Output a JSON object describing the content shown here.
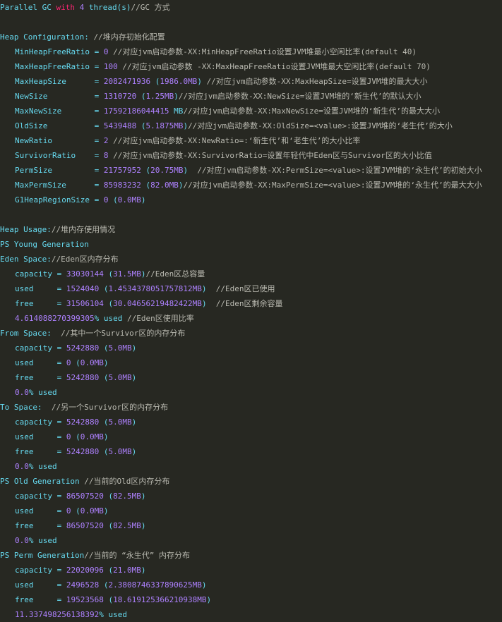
{
  "colors": {
    "background": "#272822",
    "keyword": "#66d9ef",
    "number": "#ae81ff",
    "reserved": "#f92672",
    "comment": "#b9b9b0",
    "text": "#f8f8f2"
  },
  "lines": [
    {
      "y": 0,
      "tokens": [
        {
          "t": "Parallel GC ",
          "s": "k"
        },
        {
          "t": "with",
          "s": "r"
        },
        {
          "t": " ",
          "s": "p"
        },
        {
          "t": "4",
          "s": "m"
        },
        {
          "t": " thread(s)",
          "s": "k"
        },
        {
          "t": "//GC 方式",
          "s": "c"
        }
      ]
    },
    {
      "y": 1,
      "tokens": []
    },
    {
      "y": 2,
      "tokens": [
        {
          "t": "Heap Configuration: ",
          "s": "k"
        },
        {
          "t": "//堆内存初始化配置",
          "s": "c"
        }
      ]
    },
    {
      "y": 3,
      "indent": 1,
      "tokens": [
        {
          "t": "MinHeapFreeRatio = ",
          "s": "k"
        },
        {
          "t": "0",
          "s": "m"
        },
        {
          "t": " //对应jvm启动参数-XX:MinHeapFreeRatio设置JVM堆最小空闲比率(default 40)",
          "s": "c"
        }
      ]
    },
    {
      "y": 4,
      "indent": 1,
      "tokens": [
        {
          "t": "MaxHeapFreeRatio = ",
          "s": "k"
        },
        {
          "t": "100",
          "s": "m"
        },
        {
          "t": " //对应jvm启动参数 -XX:MaxHeapFreeRatio设置JVM堆最大空闲比率(default 70)",
          "s": "c"
        }
      ]
    },
    {
      "y": 5,
      "indent": 1,
      "tokens": [
        {
          "t": "MaxHeapSize      = ",
          "s": "k"
        },
        {
          "t": "2082471936",
          "s": "m"
        },
        {
          "t": " (",
          "s": "k"
        },
        {
          "t": "1986.0MB",
          "s": "m"
        },
        {
          "t": ") ",
          "s": "k"
        },
        {
          "t": "//对应jvm启动参数-XX:MaxHeapSize=设置JVM堆的最大大小",
          "s": "c"
        }
      ]
    },
    {
      "y": 6,
      "indent": 1,
      "tokens": [
        {
          "t": "NewSize          = ",
          "s": "k"
        },
        {
          "t": "1310720",
          "s": "m"
        },
        {
          "t": " (",
          "s": "k"
        },
        {
          "t": "1.25MB",
          "s": "m"
        },
        {
          "t": ")",
          "s": "k"
        },
        {
          "t": "//对应jvm启动参数-XX:NewSize=设置JVM堆的‘新生代’的默认大小",
          "s": "c"
        }
      ]
    },
    {
      "y": 7,
      "indent": 1,
      "tokens": [
        {
          "t": "MaxNewSize       = ",
          "s": "k"
        },
        {
          "t": "17592186044415",
          "s": "m"
        },
        {
          "t": " MB",
          "s": "k"
        },
        {
          "t": "//对应jvm启动参数-XX:MaxNewSize=设置JVM堆的‘新生代’的最大大小",
          "s": "c"
        }
      ]
    },
    {
      "y": 8,
      "indent": 1,
      "tokens": [
        {
          "t": "OldSize          = ",
          "s": "k"
        },
        {
          "t": "5439488",
          "s": "m"
        },
        {
          "t": " (",
          "s": "k"
        },
        {
          "t": "5.1875MB",
          "s": "m"
        },
        {
          "t": ")",
          "s": "k"
        },
        {
          "t": "//对应jvm启动参数-XX:OldSize=<value>:设置JVM堆的‘老生代’的大小",
          "s": "c"
        }
      ]
    },
    {
      "y": 9,
      "indent": 1,
      "tokens": [
        {
          "t": "NewRatio         = ",
          "s": "k"
        },
        {
          "t": "2",
          "s": "m"
        },
        {
          "t": " //对应jvm启动参数-XX:NewRatio=:‘新生代’和‘老生代’的大小比率",
          "s": "c"
        }
      ]
    },
    {
      "y": 10,
      "indent": 1,
      "tokens": [
        {
          "t": "SurvivorRatio    = ",
          "s": "k"
        },
        {
          "t": "8",
          "s": "m"
        },
        {
          "t": " //对应jvm启动参数-XX:SurvivorRatio=设置年轻代中Eden区与Survivor区的大小比值",
          "s": "c"
        }
      ]
    },
    {
      "y": 11,
      "indent": 1,
      "tokens": [
        {
          "t": "PermSize         = ",
          "s": "k"
        },
        {
          "t": "21757952",
          "s": "m"
        },
        {
          "t": " (",
          "s": "k"
        },
        {
          "t": "20.75MB",
          "s": "m"
        },
        {
          "t": ")  ",
          "s": "k"
        },
        {
          "t": "//对应jvm启动参数-XX:PermSize=<value>:设置JVM堆的‘永生代’的初始大小",
          "s": "c"
        }
      ]
    },
    {
      "y": 12,
      "indent": 1,
      "tokens": [
        {
          "t": "MaxPermSize      = ",
          "s": "k"
        },
        {
          "t": "85983232",
          "s": "m"
        },
        {
          "t": " (",
          "s": "k"
        },
        {
          "t": "82.0MB",
          "s": "m"
        },
        {
          "t": ")",
          "s": "k"
        },
        {
          "t": "//对应jvm启动参数-XX:MaxPermSize=<value>:设置JVM堆的‘永生代’的最大大小",
          "s": "c"
        }
      ]
    },
    {
      "y": 13,
      "indent": 1,
      "tokens": [
        {
          "t": "G1HeapRegionSize = ",
          "s": "k"
        },
        {
          "t": "0",
          "s": "m"
        },
        {
          "t": " (",
          "s": "k"
        },
        {
          "t": "0.0MB",
          "s": "m"
        },
        {
          "t": ")",
          "s": "k"
        }
      ]
    },
    {
      "y": 14,
      "tokens": []
    },
    {
      "y": 15,
      "tokens": [
        {
          "t": "Heap Usage:",
          "s": "k"
        },
        {
          "t": "//堆内存使用情况",
          "s": "c"
        }
      ]
    },
    {
      "y": 16,
      "tokens": [
        {
          "t": "PS Young Generation",
          "s": "k"
        }
      ]
    },
    {
      "y": 17,
      "tokens": [
        {
          "t": "Eden Space:",
          "s": "k"
        },
        {
          "t": "//Eden区内存分布",
          "s": "c"
        }
      ]
    },
    {
      "y": 18,
      "indent": 1,
      "tokens": [
        {
          "t": "capacity = ",
          "s": "k"
        },
        {
          "t": "33030144",
          "s": "m"
        },
        {
          "t": " (",
          "s": "k"
        },
        {
          "t": "31.5MB",
          "s": "m"
        },
        {
          "t": ")",
          "s": "k"
        },
        {
          "t": "//Eden区总容量",
          "s": "c"
        }
      ]
    },
    {
      "y": 19,
      "indent": 1,
      "tokens": [
        {
          "t": "used     = ",
          "s": "k"
        },
        {
          "t": "1524040",
          "s": "m"
        },
        {
          "t": " (",
          "s": "k"
        },
        {
          "t": "1.4534378051757812MB",
          "s": "m"
        },
        {
          "t": ")  ",
          "s": "k"
        },
        {
          "t": "//Eden区已使用",
          "s": "c"
        }
      ]
    },
    {
      "y": 20,
      "indent": 1,
      "tokens": [
        {
          "t": "free     = ",
          "s": "k"
        },
        {
          "t": "31506104",
          "s": "m"
        },
        {
          "t": " (",
          "s": "k"
        },
        {
          "t": "30.04656219482422MB",
          "s": "m"
        },
        {
          "t": ")  ",
          "s": "k"
        },
        {
          "t": "//Eden区剩余容量",
          "s": "c"
        }
      ]
    },
    {
      "y": 21,
      "indent": 1,
      "tokens": [
        {
          "t": "4.614088270399305",
          "s": "m"
        },
        {
          "t": "% used ",
          "s": "k"
        },
        {
          "t": "//Eden区使用比率",
          "s": "c"
        }
      ]
    },
    {
      "y": 22,
      "tokens": [
        {
          "t": "From Space:  ",
          "s": "k"
        },
        {
          "t": "//其中一个Survivor区的内存分布",
          "s": "c"
        }
      ]
    },
    {
      "y": 23,
      "indent": 1,
      "tokens": [
        {
          "t": "capacity = ",
          "s": "k"
        },
        {
          "t": "5242880",
          "s": "m"
        },
        {
          "t": " (",
          "s": "k"
        },
        {
          "t": "5.0MB",
          "s": "m"
        },
        {
          "t": ")",
          "s": "k"
        }
      ]
    },
    {
      "y": 24,
      "indent": 1,
      "tokens": [
        {
          "t": "used     = ",
          "s": "k"
        },
        {
          "t": "0",
          "s": "m"
        },
        {
          "t": " (",
          "s": "k"
        },
        {
          "t": "0.0MB",
          "s": "m"
        },
        {
          "t": ")",
          "s": "k"
        }
      ]
    },
    {
      "y": 25,
      "indent": 1,
      "tokens": [
        {
          "t": "free     = ",
          "s": "k"
        },
        {
          "t": "5242880",
          "s": "m"
        },
        {
          "t": " (",
          "s": "k"
        },
        {
          "t": "5.0MB",
          "s": "m"
        },
        {
          "t": ")",
          "s": "k"
        }
      ]
    },
    {
      "y": 26,
      "indent": 1,
      "tokens": [
        {
          "t": "0.0",
          "s": "m"
        },
        {
          "t": "% used",
          "s": "k"
        }
      ]
    },
    {
      "y": 27,
      "tokens": [
        {
          "t": "To Space:  ",
          "s": "k"
        },
        {
          "t": "//另一个Survivor区的内存分布",
          "s": "c"
        }
      ]
    },
    {
      "y": 28,
      "indent": 1,
      "tokens": [
        {
          "t": "capacity = ",
          "s": "k"
        },
        {
          "t": "5242880",
          "s": "m"
        },
        {
          "t": " (",
          "s": "k"
        },
        {
          "t": "5.0MB",
          "s": "m"
        },
        {
          "t": ")",
          "s": "k"
        }
      ]
    },
    {
      "y": 29,
      "indent": 1,
      "tokens": [
        {
          "t": "used     = ",
          "s": "k"
        },
        {
          "t": "0",
          "s": "m"
        },
        {
          "t": " (",
          "s": "k"
        },
        {
          "t": "0.0MB",
          "s": "m"
        },
        {
          "t": ")",
          "s": "k"
        }
      ]
    },
    {
      "y": 30,
      "indent": 1,
      "tokens": [
        {
          "t": "free     = ",
          "s": "k"
        },
        {
          "t": "5242880",
          "s": "m"
        },
        {
          "t": " (",
          "s": "k"
        },
        {
          "t": "5.0MB",
          "s": "m"
        },
        {
          "t": ")",
          "s": "k"
        }
      ]
    },
    {
      "y": 31,
      "indent": 1,
      "tokens": [
        {
          "t": "0.0",
          "s": "m"
        },
        {
          "t": "% used",
          "s": "k"
        }
      ]
    },
    {
      "y": 32,
      "tokens": [
        {
          "t": "PS Old Generation ",
          "s": "k"
        },
        {
          "t": "//当前的Old区内存分布",
          "s": "c"
        }
      ]
    },
    {
      "y": 33,
      "indent": 1,
      "tokens": [
        {
          "t": "capacity = ",
          "s": "k"
        },
        {
          "t": "86507520",
          "s": "m"
        },
        {
          "t": " (",
          "s": "k"
        },
        {
          "t": "82.5MB",
          "s": "m"
        },
        {
          "t": ")",
          "s": "k"
        }
      ]
    },
    {
      "y": 34,
      "indent": 1,
      "tokens": [
        {
          "t": "used     = ",
          "s": "k"
        },
        {
          "t": "0",
          "s": "m"
        },
        {
          "t": " (",
          "s": "k"
        },
        {
          "t": "0.0MB",
          "s": "m"
        },
        {
          "t": ")",
          "s": "k"
        }
      ]
    },
    {
      "y": 35,
      "indent": 1,
      "tokens": [
        {
          "t": "free     = ",
          "s": "k"
        },
        {
          "t": "86507520",
          "s": "m"
        },
        {
          "t": " (",
          "s": "k"
        },
        {
          "t": "82.5MB",
          "s": "m"
        },
        {
          "t": ")",
          "s": "k"
        }
      ]
    },
    {
      "y": 36,
      "indent": 1,
      "tokens": [
        {
          "t": "0.0",
          "s": "m"
        },
        {
          "t": "% used",
          "s": "k"
        }
      ]
    },
    {
      "y": 37,
      "tokens": [
        {
          "t": "PS Perm Generation",
          "s": "k"
        },
        {
          "t": "//当前的 “永生代” 内存分布",
          "s": "c"
        }
      ]
    },
    {
      "y": 38,
      "indent": 1,
      "tokens": [
        {
          "t": "capacity = ",
          "s": "k"
        },
        {
          "t": "22020096",
          "s": "m"
        },
        {
          "t": " (",
          "s": "k"
        },
        {
          "t": "21.0MB",
          "s": "m"
        },
        {
          "t": ")",
          "s": "k"
        }
      ]
    },
    {
      "y": 39,
      "indent": 1,
      "tokens": [
        {
          "t": "used     = ",
          "s": "k"
        },
        {
          "t": "2496528",
          "s": "m"
        },
        {
          "t": " (",
          "s": "k"
        },
        {
          "t": "2.3808746337890625MB",
          "s": "m"
        },
        {
          "t": ")",
          "s": "k"
        }
      ]
    },
    {
      "y": 40,
      "indent": 1,
      "tokens": [
        {
          "t": "free     = ",
          "s": "k"
        },
        {
          "t": "19523568",
          "s": "m"
        },
        {
          "t": " (",
          "s": "k"
        },
        {
          "t": "18.619125366210938MB",
          "s": "m"
        },
        {
          "t": ")",
          "s": "k"
        }
      ]
    },
    {
      "y": 41,
      "indent": 1,
      "tokens": [
        {
          "t": "11.337498256138392",
          "s": "m"
        },
        {
          "t": "% used",
          "s": "k"
        }
      ]
    }
  ]
}
